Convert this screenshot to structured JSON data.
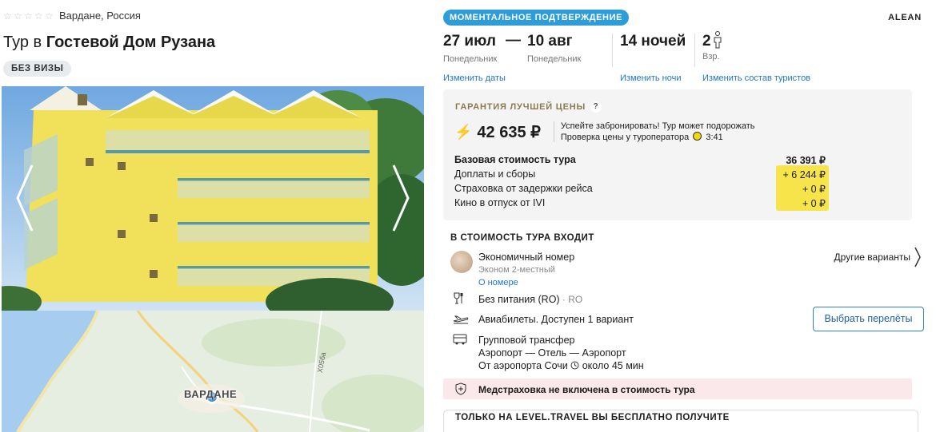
{
  "hotel": {
    "stars_total": 5,
    "stars_filled": 0,
    "location": "Вардане, Россия",
    "title_prefix": "Тур в ",
    "title_name": "Гостевой Дом Рузана",
    "visa_badge": "БЕЗ ВИЗЫ"
  },
  "map": {
    "place_label": "ВАРДАНЕ",
    "road_label": "Х05ба"
  },
  "header": {
    "instant_badge": "МОМЕНТАЛЬНОЕ ПОДТВЕРЖДЕНИЕ",
    "operator": "ALEAN"
  },
  "dates": {
    "from_date": "27 июл",
    "from_day": "Понедельник",
    "separator": "—",
    "to_date": "10 авг",
    "to_day": "Понедельник",
    "nights": "14 ночей",
    "tourists_count": "2",
    "tourists_label": "Взр.",
    "change_dates": "Изменить даты",
    "change_nights": "Изменить ночи",
    "change_tourists": "Изменить состав туристов"
  },
  "price": {
    "guarantee": "ГАРАНТИЯ ЛУЧШЕЙ ЦЕНЫ",
    "question": "?",
    "total": "42 635 ₽",
    "hurry_line1": "Успейте забронировать! Тур может подорожать",
    "hurry_line2": "Проверка цены у туроператора",
    "timer": "3:41",
    "lines": [
      {
        "label": "Базовая стоимость тура",
        "value": "36 391 ₽"
      },
      {
        "label": "Доплаты и сборы",
        "value": "+ 6 244 ₽"
      },
      {
        "label": "Страховка от задержки рейса",
        "value": "+ 0 ₽"
      },
      {
        "label": "Кино в отпуск от IVI",
        "value": "+ 0 ₽"
      }
    ]
  },
  "included": {
    "title": "В СТОИМОСТЬ ТУРА ВХОДИТ",
    "room_name": "Экономичный номер",
    "room_type": "Эконом 2-местный",
    "room_link": "О номере",
    "other_variants": "Другие варианты",
    "meal": "Без питания (RO)",
    "meal_code": " · RO",
    "flights": "Авиабилеты. Доступен 1 вариант",
    "choose_flights": "Выбрать перелёты",
    "transfer_title": "Групповой трансфер",
    "transfer_route": "Аэропорт — Отель — Аэропорт",
    "transfer_from": "От аэропорта Сочи",
    "transfer_time": "около 45 мин"
  },
  "medical": {
    "text": "Медстраховка не включена в стоимость тура"
  },
  "free": {
    "title": "ТОЛЬКО НА LEVEL.TRAVEL ВЫ БЕСПЛАТНО ПОЛУЧИТЕ"
  },
  "colors": {
    "accent_blue": "#2d9cdb",
    "link_blue": "#1f75c9",
    "highlight_yellow": "#f7e44a",
    "warning_pink": "#fbe8ea"
  }
}
